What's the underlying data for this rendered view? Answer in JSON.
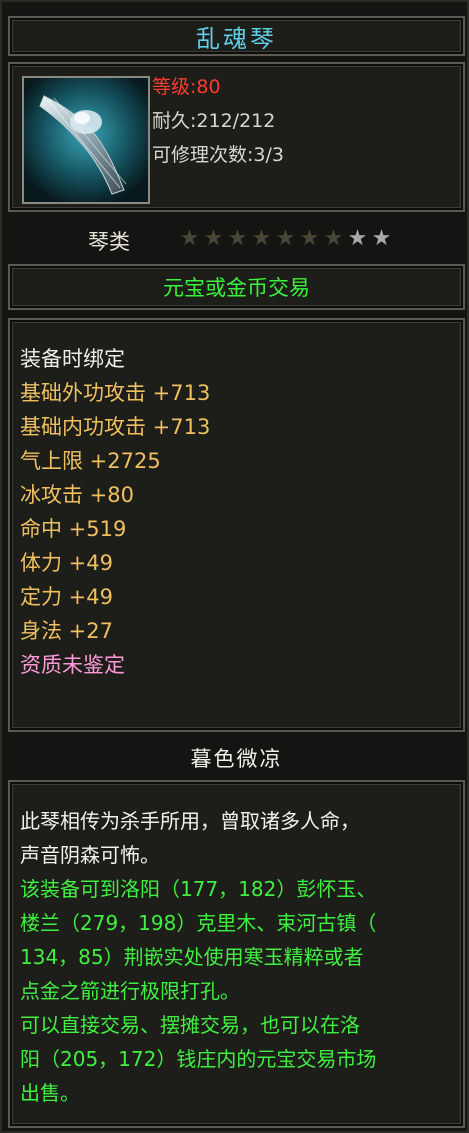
{
  "item": {
    "name": "乱魂琴",
    "level": "等级:80",
    "durability": "耐久:212/212",
    "repair": "可修理次数:3/3",
    "type": "琴类",
    "stars_total": 9,
    "stars_lit": 2,
    "trade": "元宝或金币交易"
  },
  "attributes": [
    {
      "text": "装备时绑定",
      "color": "white"
    },
    {
      "text": "基础外功攻击 +713",
      "color": "gold"
    },
    {
      "text": "基础内功攻击 +713",
      "color": "gold"
    },
    {
      "text": "气上限 +2725",
      "color": "gold"
    },
    {
      "text": "冰攻击 +80",
      "color": "gold"
    },
    {
      "text": "命中 +519",
      "color": "gold"
    },
    {
      "text": "体力 +49",
      "color": "gold"
    },
    {
      "text": "定力 +49",
      "color": "gold"
    },
    {
      "text": "身法 +27",
      "color": "gold"
    },
    {
      "text": "资质未鉴定",
      "color": "pink"
    }
  ],
  "subtitle": "暮色微凉",
  "description": [
    {
      "text": "此琴相传为杀手所用，曾取诸多人命，",
      "color": "white"
    },
    {
      "text": "声音阴森可怖。",
      "color": "white"
    },
    {
      "text": "该装备可到洛阳（177，182）彭怀玉、",
      "color": "green"
    },
    {
      "text": "楼兰（279，198）克里木、束河古镇（",
      "color": "green"
    },
    {
      "text": "134，85）荆嵌实处使用寒玉精粹或者",
      "color": "green"
    },
    {
      "text": "点金之箭进行极限打孔。",
      "color": "green"
    },
    {
      "text": "可以直接交易、摆摊交易，也可以在洛",
      "color": "green"
    },
    {
      "text": "阳（205，172）钱庄内的元宝交易市场",
      "color": "green"
    },
    {
      "text": "出售。",
      "color": "green"
    }
  ],
  "colors": {
    "title": "#5fd0e6",
    "level": "#ff3b2e",
    "attribute": "#f0c060",
    "unidentified": "#ff9ad8",
    "trade": "#3cf23c",
    "description_green": "#40f040"
  },
  "icons": {
    "item_icon": "guqin-item-icon",
    "star": "star-icon"
  }
}
